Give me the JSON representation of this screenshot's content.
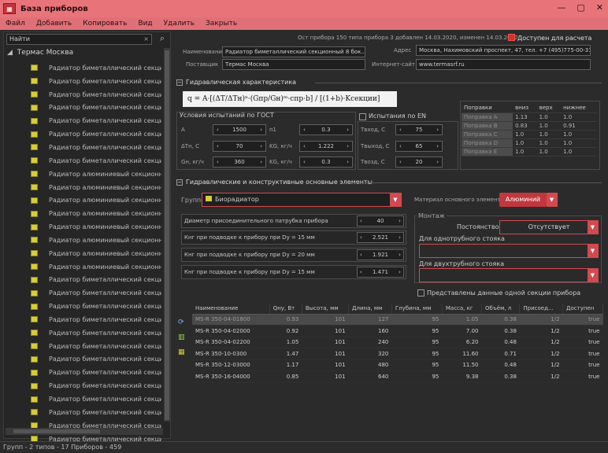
{
  "title": "База приборов",
  "menu": [
    "Файл",
    "Добавить",
    "Копировать",
    "Вид",
    "Удалить",
    "Закрыть"
  ],
  "search": {
    "value": "Найти",
    "clear": "×"
  },
  "tree": {
    "root": "Термас Москва",
    "items": [
      "Радиатор биметаллический секционный ...",
      "Радиатор биметаллический секционный ...",
      "Радиатор биметаллический секционный ...",
      "Радиатор биметаллический секционный ...",
      "Радиатор биметаллический секционный ...",
      "Радиатор биметаллический секционный ...",
      "Радиатор биметаллический секционный ...",
      "Радиатор биметаллический секционный ...",
      "Радиатор алюминиевый секционный R...",
      "Радиатор алюминиевый секционный R...",
      "Радиатор алюминиевый секционный R...",
      "Радиатор алюминиевый секционный R...",
      "Радиатор алюминиевый секционный R...",
      "Радиатор алюминиевый секционный R...",
      "Радиатор алюминиевый секционный R...",
      "Радиатор алюминиевый секционный R...",
      "Радиатор биметаллический секционный ...",
      "Радиатор биметаллический секционный ...",
      "Радиатор биметаллический секционный ...",
      "Радиатор биметаллический секционный ...",
      "Радиатор биметаллический секционный ...",
      "Радиатор биметаллический секционный ...",
      "Радиатор биметаллический секционный ...",
      "Радиатор биметаллический секционный ...",
      "Радиатор биметаллический секционный ...",
      "Радиатор биметаллический секционный ...",
      "Радиатор биметаллический секционный ...",
      "Радиатор биметаллический секционный ...",
      "Радиатор биметаллический секционный ..."
    ]
  },
  "top": {
    "info": "Ост прибора 150 типа прибора 3 добавлен 14.03.2020, изменен 14.03.2020",
    "available_label": "Доступен для расчета",
    "name_label": "Наименование",
    "name_value": "Радиатор биметаллический секционный 8 бок...",
    "supplier_label": "Поставщик",
    "supplier_value": "Термас Москва",
    "address_label": "Адрес",
    "address_value": "Москва, Нахимовский проспект, 47, тел. +7 (495)775-00-31",
    "site_label": "Интернет-сайт",
    "site_value": "www.termasrf.ru"
  },
  "hydro": {
    "header": "Гидравлическая характеристика",
    "formula": "q = A·[(ΔT/ΔTн)ⁿ·(Gпр/Gн)ᵐ·cпр·b] / [(1+b)·Kсекции]",
    "gost_label": "Условия испытаний по ГОСТ",
    "en_label": "Испытания по EN",
    "left_labels": [
      "A",
      "ΔTн, С",
      "Gн, кг/ч"
    ],
    "left_values": [
      "1500",
      "70",
      "360"
    ],
    "mid_labels": [
      "n1",
      "KG, кг/ч",
      "KG, кг/ч"
    ],
    "mid_values": [
      "0.3",
      "1.222",
      "0.3"
    ],
    "en_labels": [
      "Твход, С",
      "Твыход, С",
      "Твозд, С"
    ],
    "en_values": [
      "75",
      "65",
      "20"
    ],
    "table_headers": [
      "Поправки",
      "вниз",
      "верх",
      "нижнее"
    ],
    "table_rows": [
      [
        "Поправка A",
        "1.13",
        "1.0",
        "1.0"
      ],
      [
        "Поправка B",
        "0.83",
        "1.0",
        "0.91"
      ],
      [
        "Поправка C",
        "1.0",
        "1.0",
        "1.0"
      ],
      [
        "Поправка D",
        "1.0",
        "1.0",
        "1.0"
      ],
      [
        "Поправка E",
        "1.0",
        "1.0",
        "1.0"
      ]
    ]
  },
  "geo": {
    "header": "Гидравлические и конструктивные основные элементы",
    "group_label": "Группа",
    "group_value": "Биорадиатор",
    "material_label": "Материал основного элемента",
    "material_value": "Алюминий",
    "params": [
      {
        "label": "Диаметр присоединительного патрубка прибора",
        "value": "40"
      },
      {
        "label": "Кнг при подводке к прибору при Dу = 15 мм",
        "value": "2.521"
      },
      {
        "label": "Кнг при подводке к прибору при Dу = 20 мм",
        "value": "1.921"
      },
      {
        "label": "Кнг при подводке к прибору при Dу = 15 мм",
        "value": "1.471"
      }
    ],
    "mount_label": "Монтаж",
    "mount_value": "Отсутствует",
    "post_label": "Постоянство",
    "single_label": "Для однотрубного стояка",
    "double_label": "Для двухтрубного стояка",
    "section_checkbox": "Представлены данные одной секции прибора"
  },
  "table": {
    "columns": [
      "Наименование",
      "Qну, Вт",
      "Высота, мм",
      "Длина, мм",
      "Глубина, мм",
      "Масса, кг",
      "Объём, л",
      "Присоед...",
      "Доступен"
    ],
    "rows": [
      [
        "MS-R 350-04-01800",
        "0.93",
        "101",
        "127",
        "95",
        "1.05",
        "0.38",
        "1/2",
        "true"
      ],
      [
        "MS-R 350-04-02000",
        "0.92",
        "101",
        "160",
        "95",
        "7.00",
        "0.38",
        "1/2",
        "true"
      ],
      [
        "MS-R 350-04-02200",
        "1.05",
        "101",
        "240",
        "95",
        "6.20",
        "0.48",
        "1/2",
        "true"
      ],
      [
        "MS-R 350-10-0300",
        "1.47",
        "101",
        "320",
        "95",
        "11.60",
        "0.71",
        "1/2",
        "true"
      ],
      [
        "MS-R 350-12-03000",
        "1.17",
        "101",
        "480",
        "95",
        "11.50",
        "0.48",
        "1/2",
        "true"
      ],
      [
        "MS-R 350-16-04000",
        "0.85",
        "101",
        "640",
        "95",
        "9.38",
        "0.38",
        "1/2",
        "true"
      ]
    ]
  },
  "status": "Групп - 2 типов - 17 Приборов - 459"
}
